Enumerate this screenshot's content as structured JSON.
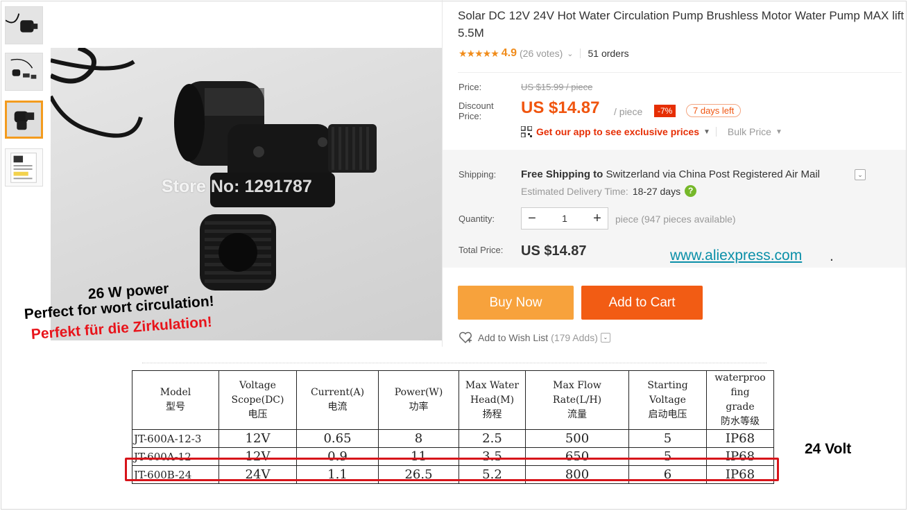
{
  "product": {
    "title": "Solar DC 12V 24V Hot Water Circulation Pump Brushless Motor Water Pump MAX lift 5.5M",
    "rating_score": "4.9",
    "votes": "(26 votes)",
    "orders": "51 orders",
    "watermark": "Store No: 1291787"
  },
  "price": {
    "price_label": "Price:",
    "old_price": "US $15.99 / piece",
    "discount_label": "Discount Price:",
    "discount_price": "US $14.87",
    "per_piece": "/ piece",
    "discount_badge": "-7%",
    "days_left": "7 days left",
    "app_text": "Get our app to see exclusive prices",
    "bulk_price": "Bulk Price"
  },
  "shipping": {
    "label": "Shipping:",
    "free_text": "Free Shipping to",
    "destination": "Switzerland via China Post Registered Air Mail",
    "delivery_label": "Estimated Delivery Time:",
    "delivery_days": "18-27 days"
  },
  "quantity": {
    "label": "Quantity:",
    "minus": "−",
    "value": "1",
    "plus": "+",
    "available": "piece (947 pieces available)"
  },
  "total": {
    "label": "Total Price:",
    "value": "US $14.87"
  },
  "site_link": "www.aliexpress.com",
  "site_link_suffix": ".",
  "buttons": {
    "buy_now": "Buy Now",
    "add_to_cart": "Add to Cart",
    "wishlist": "Add to Wish List",
    "wishlist_adds": "(179 Adds)"
  },
  "captions": {
    "power": "26 W power",
    "english": "Perfect for wort circulation!",
    "german": "Perfekt für die Zirkulation!",
    "volt": "24 Volt"
  },
  "specs_table": {
    "headers": [
      [
        "Model",
        "型号"
      ],
      [
        "Voltage",
        "Scope(DC)",
        "电压"
      ],
      [
        "Current(A)",
        "电流"
      ],
      [
        "Power(W)",
        "功率"
      ],
      [
        "Max Water",
        "Head(M)",
        "扬程"
      ],
      [
        "Max Flow",
        "Rate(L/H)",
        "流量"
      ],
      [
        "Starting",
        "Voltage",
        "启动电压"
      ],
      [
        "waterproo",
        "fing",
        "grade",
        "防水等级"
      ]
    ],
    "rows": [
      [
        "JT-600A-12-3",
        "12V",
        "0.65",
        "8",
        "2.5",
        "500",
        "5",
        "IP68"
      ],
      [
        "JT-600A-12",
        "12V",
        "0.9",
        "11",
        "3.5",
        "650",
        "5",
        "IP68"
      ],
      [
        "JT-600B-24",
        "24V",
        "1.1",
        "26.5",
        "5.2",
        "800",
        "6",
        "IP68"
      ]
    ]
  },
  "colors": {
    "accent_orange": "#f0550f",
    "buy_now": "#f7a23c",
    "add_to_cart": "#f25c14",
    "highlight_red": "#d7141a",
    "link_teal": "#0a8fa8"
  }
}
